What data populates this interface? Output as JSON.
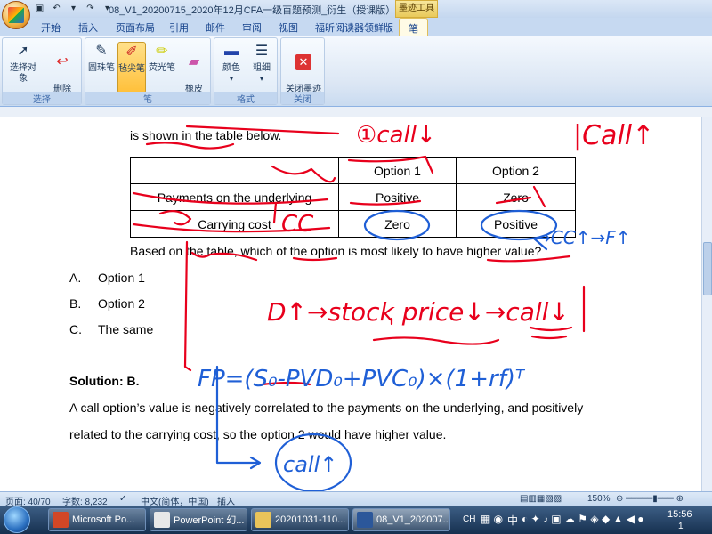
{
  "window": {
    "title": "08_V1_20200715_2020年12月CFA一级百题预测_衍生（授课版） - Mic...",
    "context_tab_group": "墨迹工具"
  },
  "tabs": [
    {
      "label": "开始"
    },
    {
      "label": "插入"
    },
    {
      "label": "页面布局"
    },
    {
      "label": "引用"
    },
    {
      "label": "邮件"
    },
    {
      "label": "审阅"
    },
    {
      "label": "视图"
    },
    {
      "label": "福昕阅读器领鲜版"
    },
    {
      "label": "笔"
    }
  ],
  "ribbon": {
    "groups": [
      {
        "label": "选择",
        "buttons": [
          "选择对象",
          "删除\n所有墨迹"
        ]
      },
      {
        "label": "笔",
        "buttons": [
          "圆珠笔",
          "毡尖笔",
          "荧光笔",
          "橡皮\n擦"
        ]
      },
      {
        "label": "格式",
        "buttons": [
          "颜色",
          "粗细"
        ]
      },
      {
        "label": "关闭",
        "buttons": [
          "关闭墨迹\n书写工具"
        ]
      }
    ]
  },
  "document": {
    "intro_line": "is shown in the table below.",
    "table": {
      "header": [
        "",
        "Option 1",
        "Option 2"
      ],
      "rows": [
        [
          "Payments on the underlying",
          "Positive",
          "Zero"
        ],
        [
          "Carrying cost",
          "Zero",
          "Positive"
        ]
      ]
    },
    "question": "Based on the table, which of the option is most likely to have higher value?",
    "choices": [
      {
        "letter": "A.",
        "text": "Option 1"
      },
      {
        "letter": "B.",
        "text": "Option 2"
      },
      {
        "letter": "C.",
        "text": "The same"
      }
    ],
    "solution_label": "Solution: B.",
    "solution_text_1": "A call option’s value is negatively correlated to the payments on the underlying, and positively",
    "solution_text_2": "related to the carrying cost, so the option 2 would have higher value.",
    "ink_notes": {
      "call_down_top": "①call↓",
      "call_top_right": "|Call↑",
      "cc": "CC",
      "cc_arrow": "→CC↑→F↑",
      "stock_price_line": "D↑→stock price↓→call↓",
      "formula": "FP=(S₀-PVD₀+PVC₀)×(1+rf)ᵀ",
      "call_up_bottom": "call↑"
    }
  },
  "status": {
    "page": "页面: 40/70",
    "words": "字数: 8,232",
    "language": "中文(简体，中国)",
    "mode": "插入",
    "zoom": "150%"
  },
  "taskbar": {
    "buttons": [
      {
        "label": "Microsoft Po..."
      },
      {
        "label": "PowerPoint 幻..."
      },
      {
        "label": "20201031-110..."
      },
      {
        "label": "08_V1_202007..."
      }
    ],
    "tray_ime": "CH",
    "tray_lang": "中",
    "clock": "15:56",
    "clock_sub": "1"
  },
  "colors": {
    "ink_red": "#e8001c",
    "ink_blue": "#1f5fd6",
    "ribbon_blue": "#15428b"
  }
}
